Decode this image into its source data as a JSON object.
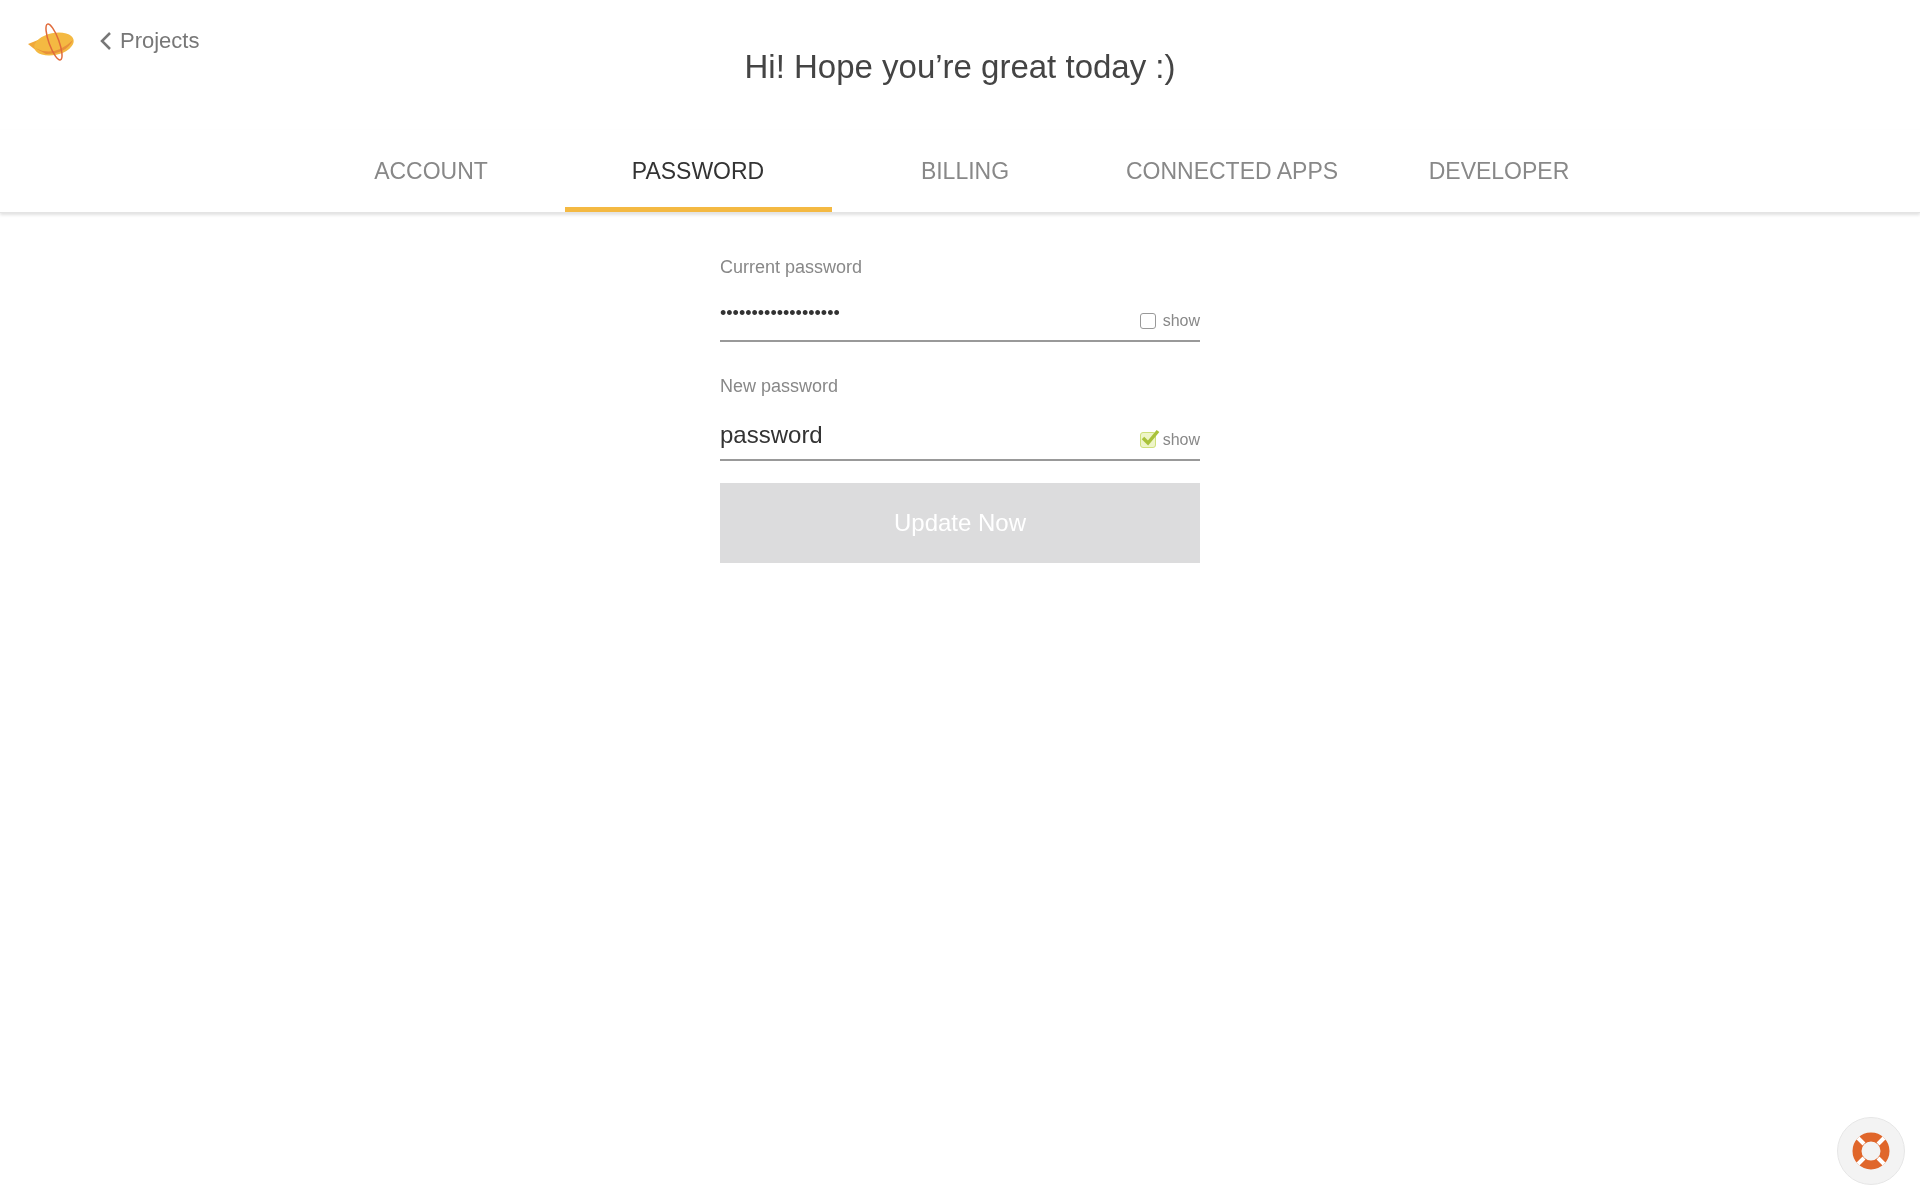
{
  "header": {
    "back_link": "Projects",
    "greeting": "Hi! Hope you’re great today :)"
  },
  "tabs": [
    {
      "label": "ACCOUNT",
      "selected": false
    },
    {
      "label": "PASSWORD",
      "selected": true
    },
    {
      "label": "BILLING",
      "selected": false
    },
    {
      "label": "CONNECTED APPS",
      "selected": false
    },
    {
      "label": "DEVELOPER",
      "selected": false
    }
  ],
  "form": {
    "fields": [
      {
        "label": "Current password",
        "value": "•••••••••••••••••••",
        "show_label": "show",
        "show_checked": false
      },
      {
        "label": "New password",
        "value": "password",
        "show_label": "show",
        "show_checked": true
      }
    ],
    "submit": {
      "label": "Update Now",
      "disabled": true
    }
  }
}
